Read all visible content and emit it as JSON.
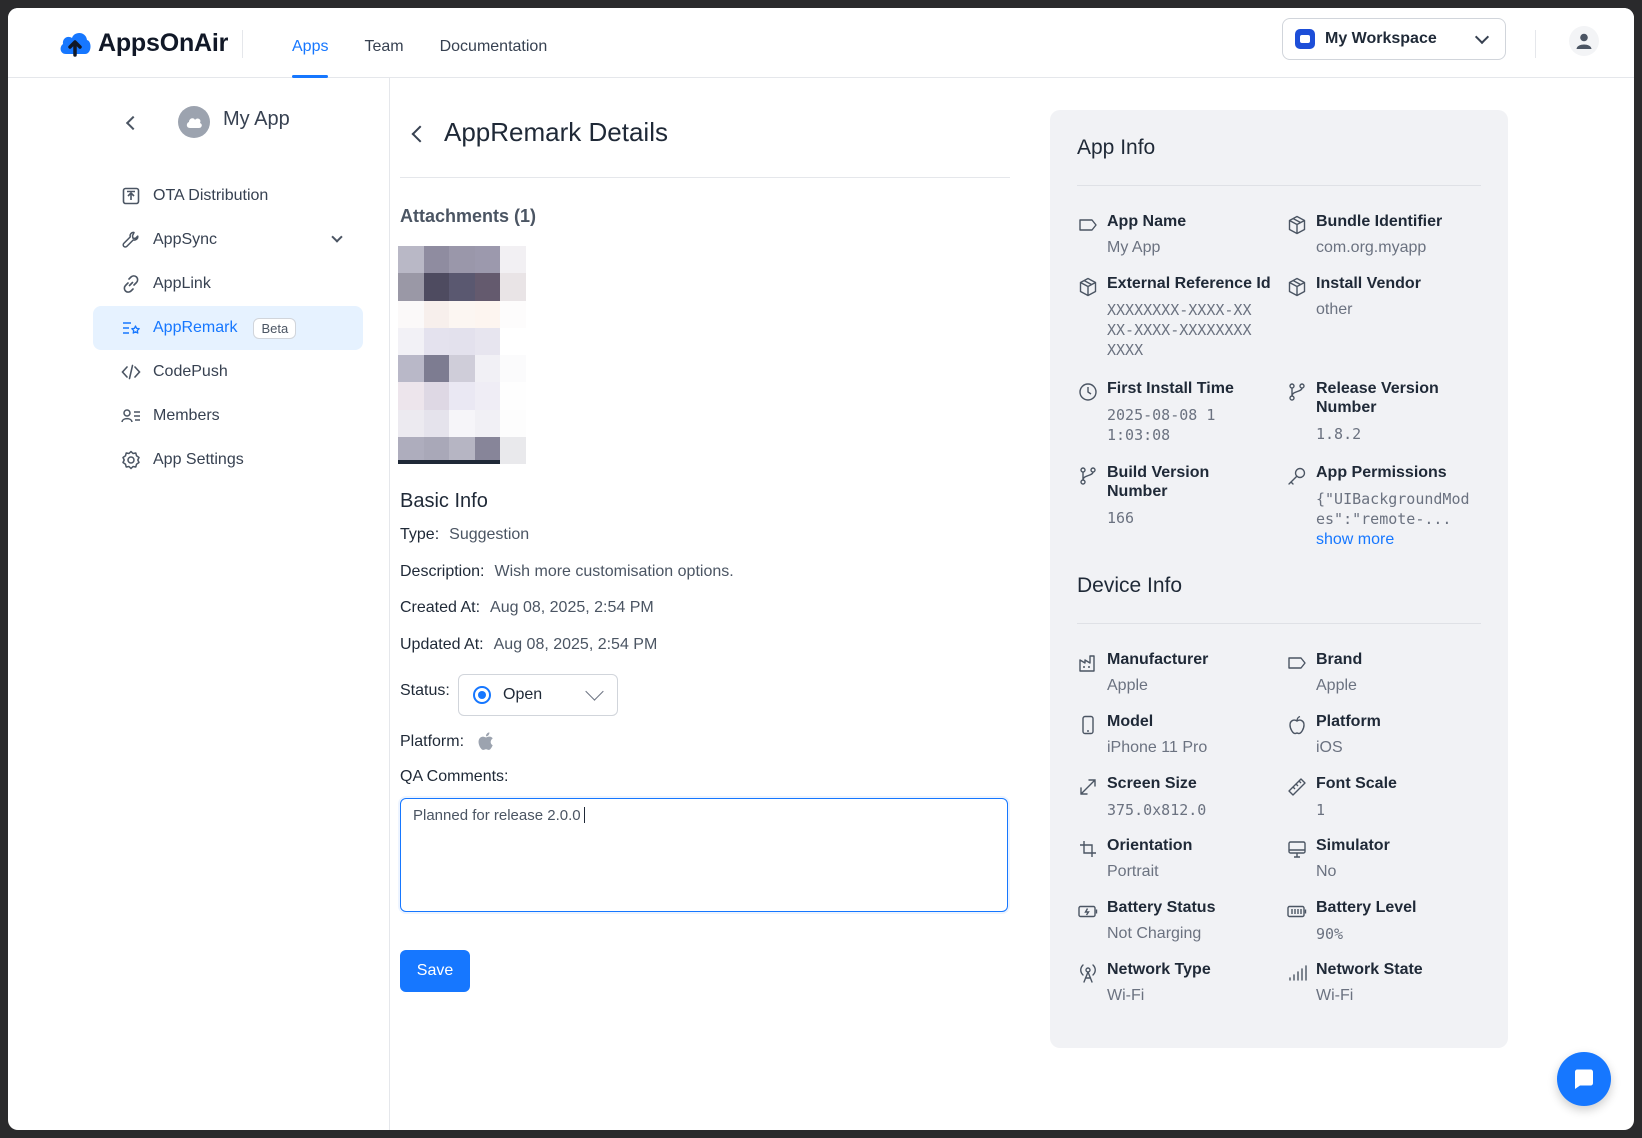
{
  "brand": {
    "name": "AppsOnAir"
  },
  "nav": {
    "items": [
      "Apps",
      "Team",
      "Documentation"
    ],
    "active": "Apps"
  },
  "workspace": {
    "label": "My Workspace"
  },
  "sidebar": {
    "app_name": "My App",
    "items": [
      {
        "label": "OTA Distribution",
        "icon": "upload-box-icon"
      },
      {
        "label": "AppSync",
        "icon": "wrench-icon"
      },
      {
        "label": "AppLink",
        "icon": "link-icon"
      },
      {
        "label": "AppRemark",
        "icon": "remark-list-icon",
        "badge": "Beta"
      },
      {
        "label": "CodePush",
        "icon": "code-icon"
      },
      {
        "label": "Members",
        "icon": "members-icon"
      },
      {
        "label": "App Settings",
        "icon": "gear-icon"
      }
    ]
  },
  "page": {
    "title": "AppRemark Details",
    "attachments_title": "Attachments (1)",
    "basic_info_title": "Basic Info",
    "type_label": "Type:",
    "type_value": "Suggestion",
    "description_label": "Description:",
    "description_value": "Wish more customisation options.",
    "created_label": "Created At:",
    "created_value": "Aug 08, 2025, 2:54 PM",
    "updated_label": "Updated At:",
    "updated_value": "Aug 08, 2025, 2:54 PM",
    "status_label": "Status:",
    "status_value": "Open",
    "platform_label": "Platform:",
    "platform_icon": "apple-icon",
    "qa_label": "QA Comments:",
    "qa_value": "Planned for release 2.0.0",
    "save_label": "Save"
  },
  "app_info": {
    "title": "App Info",
    "fields": {
      "app_name": {
        "label": "App Name",
        "value": "My App"
      },
      "bundle_id": {
        "label": "Bundle Identifier",
        "value": "com.org.myapp"
      },
      "ext_ref": {
        "label": "External Reference Id",
        "value": "XXXXXXXX-XXXX-XXXX-XXXX-XXXXXXXXXXXX"
      },
      "install_vendor": {
        "label": "Install Vendor",
        "value": "other"
      },
      "first_install": {
        "label": "First Install Time",
        "value": "2025-08-08 11:03:08"
      },
      "release_version": {
        "label": "Release Version Number",
        "value": "1.8.2"
      },
      "build_version": {
        "label": "Build Version Number",
        "value": "166"
      },
      "permissions": {
        "label": "App Permissions",
        "value": "{\"UIBackgroundModes\":\"remote-...",
        "more": "show more"
      }
    }
  },
  "device_info": {
    "title": "Device Info",
    "fields": {
      "manufacturer": {
        "label": "Manufacturer",
        "value": "Apple"
      },
      "brand": {
        "label": "Brand",
        "value": "Apple"
      },
      "model": {
        "label": "Model",
        "value": "iPhone 11 Pro"
      },
      "platform": {
        "label": "Platform",
        "value": "iOS"
      },
      "screen_size": {
        "label": "Screen Size",
        "value": "375.0x812.0"
      },
      "font_scale": {
        "label": "Font Scale",
        "value": "1"
      },
      "orientation": {
        "label": "Orientation",
        "value": "Portrait"
      },
      "simulator": {
        "label": "Simulator",
        "value": "No"
      },
      "battery_status": {
        "label": "Battery Status",
        "value": "Not Charging"
      },
      "battery_level": {
        "label": "Battery Level",
        "value": "90%"
      },
      "network_type": {
        "label": "Network Type",
        "value": "Wi-Fi"
      },
      "network_state": {
        "label": "Network State",
        "value": "Wi-Fi"
      }
    }
  },
  "colors": {
    "accent": "#1677ff",
    "active_bg": "#e6f2ff",
    "panel_bg": "#f1f2f5"
  }
}
